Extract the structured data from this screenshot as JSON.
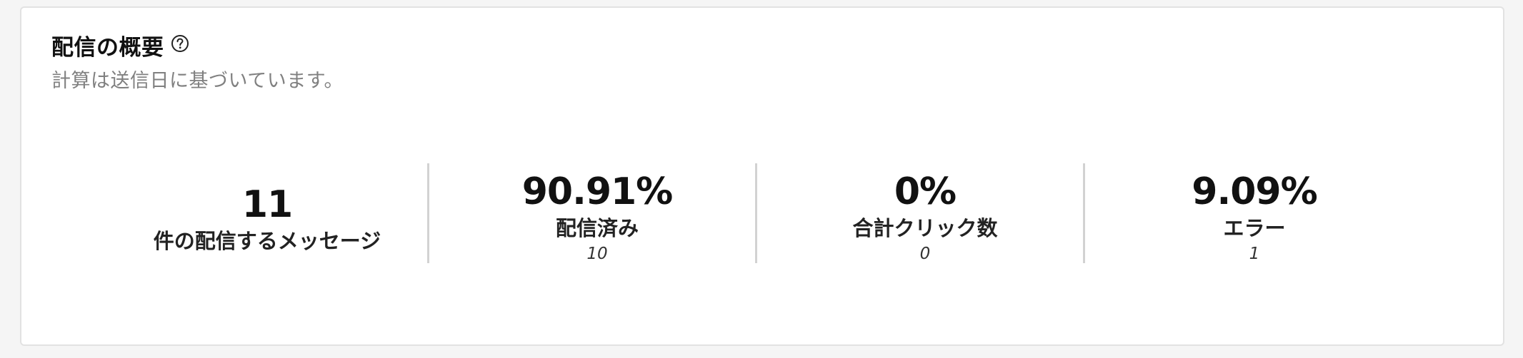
{
  "header": {
    "title": "配信の概要",
    "help_icon": "question-circle-icon",
    "subtitle": "計算は送信日に基づいています。"
  },
  "stats": [
    {
      "value": "11",
      "label": "件の配信するメッセージ"
    },
    {
      "value": "90.91%",
      "label": "配信済み",
      "count": "10"
    },
    {
      "value": "0%",
      "label": "合計クリック数",
      "count": "0"
    },
    {
      "value": "9.09%",
      "label": "エラー",
      "count": "1"
    }
  ]
}
